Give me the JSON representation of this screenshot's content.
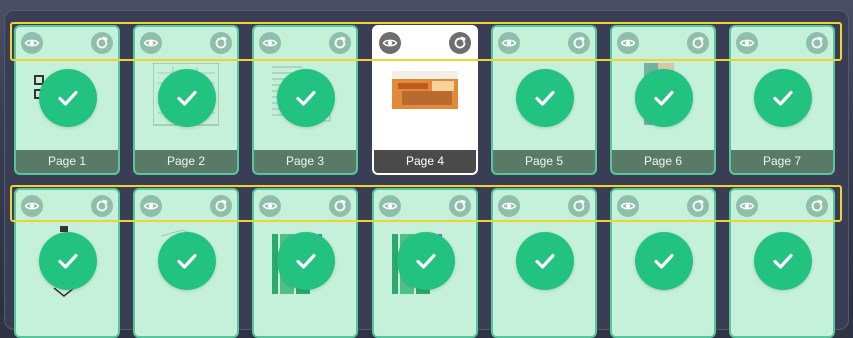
{
  "pages_row1": [
    {
      "label": "Page 1",
      "selected": false,
      "thumb": "qr-code"
    },
    {
      "label": "Page 2",
      "selected": false,
      "thumb": "form"
    },
    {
      "label": "Page 3",
      "selected": false,
      "thumb": "text-doc"
    },
    {
      "label": "Page 4",
      "selected": true,
      "thumb": "photo-banner"
    },
    {
      "label": "Page 5",
      "selected": false,
      "thumb": "blank"
    },
    {
      "label": "Page 6",
      "selected": false,
      "thumb": "photo"
    },
    {
      "label": "Page 7",
      "selected": false,
      "thumb": "blank"
    }
  ],
  "pages_row2": [
    {
      "label": "",
      "selected": false,
      "thumb": "stamp"
    },
    {
      "label": "",
      "selected": false,
      "thumb": "sketch"
    },
    {
      "label": "",
      "selected": false,
      "thumb": "green-blocks"
    },
    {
      "label": "",
      "selected": false,
      "thumb": "green-blocks"
    },
    {
      "label": "",
      "selected": false,
      "thumb": "blank"
    },
    {
      "label": "",
      "selected": false,
      "thumb": "blank"
    },
    {
      "label": "",
      "selected": false,
      "thumb": "blank"
    }
  ],
  "icons": {
    "view": "eye-icon",
    "rotate": "rotate-icon",
    "check": "check-icon"
  },
  "colors": {
    "card_fill": "#c5f0da",
    "card_border": "#56c79c",
    "check": "#22c381",
    "highlight": "#f2d230",
    "label_bg": "#5a7a68",
    "selected_label_bg": "#4a4a4a"
  }
}
